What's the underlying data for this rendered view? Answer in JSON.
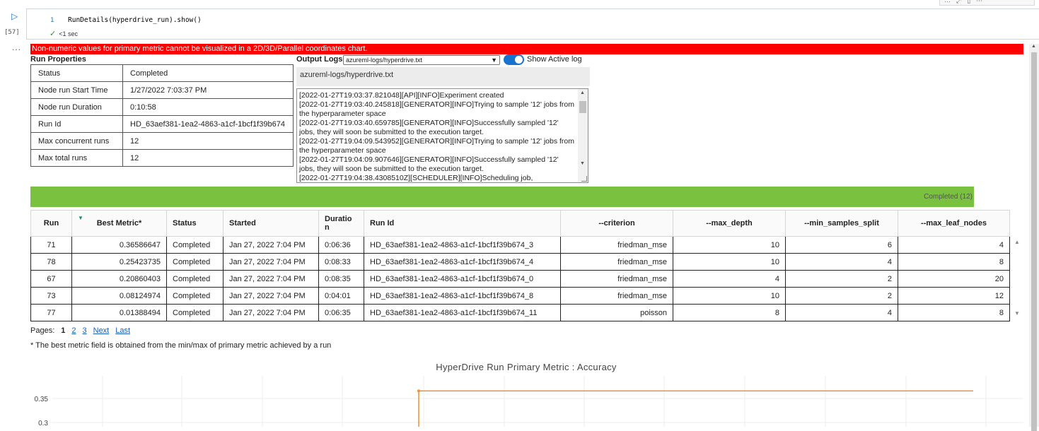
{
  "cell": {
    "execution_count": "[57]",
    "line_number": "1",
    "code": "RunDetails(hyperdrive_run).show()",
    "exec_time": "<1 sec",
    "output_prompt": "..."
  },
  "error_message": "Non-numeric values for primary metric cannot be visualized in a 2D/3D/Parallel coordinates chart.",
  "run_properties": {
    "title": "Run Properties",
    "rows": [
      {
        "key": "Status",
        "value": "Completed"
      },
      {
        "key": "Node run Start Time",
        "value": "1/27/2022 7:03:37 PM"
      },
      {
        "key": "Node run Duration",
        "value": "0:10:58"
      },
      {
        "key": "Run Id",
        "value": "HD_63aef381-1ea2-4863-a1cf-1bcf1f39b674"
      },
      {
        "key": "Max concurrent runs",
        "value": "12"
      },
      {
        "key": "Max total runs",
        "value": "12"
      }
    ]
  },
  "output_logs": {
    "title": "Output Logs",
    "selected_log": "azureml-logs/hyperdrive.txt",
    "toggle_label": "Show Active log",
    "toggle_on": true,
    "header": "azureml-logs/hyperdrive.txt",
    "lines": [
      "[2022-01-27T19:03:37.821048][API][INFO]Experiment created",
      "[2022-01-27T19:03:40.245818][GENERATOR][INFO]Trying to sample '12' jobs from the hyperparameter space",
      "[2022-01-27T19:03:40.659785][GENERATOR][INFO]Successfully sampled '12' jobs, they will soon be submitted to the execution target.",
      "[2022-01-27T19:04:09.543952][GENERATOR][INFO]Trying to sample '12' jobs from the hyperparameter space",
      "[2022-01-27T19:04:09.907646][GENERATOR][INFO]Successfully sampled '12' jobs, they will soon be submitted to the execution target.",
      "[2022-01-27T19:04:38.4308510Z][SCHEDULER][INFO]Scheduling job,"
    ]
  },
  "progress": {
    "label": "Completed (12)",
    "fraction": 1.0,
    "color": "#79c13f"
  },
  "runs": {
    "columns": [
      "Run",
      "Best Metric*",
      "Status",
      "Started",
      "Duratio n",
      "Run Id",
      "--criterion",
      "--max_depth",
      "--min_samples_split",
      "--max_leaf_nodes"
    ],
    "rows": [
      [
        "71",
        "0.36586647",
        "Completed",
        "Jan 27, 2022 7:04 PM",
        "0:06:36",
        "HD_63aef381-1ea2-4863-a1cf-1bcf1f39b674_3",
        "friedman_mse",
        "10",
        "6",
        "4"
      ],
      [
        "78",
        "0.25423735",
        "Completed",
        "Jan 27, 2022 7:04 PM",
        "0:08:33",
        "HD_63aef381-1ea2-4863-a1cf-1bcf1f39b674_4",
        "friedman_mse",
        "10",
        "4",
        "8"
      ],
      [
        "67",
        "0.20860403",
        "Completed",
        "Jan 27, 2022 7:04 PM",
        "0:08:35",
        "HD_63aef381-1ea2-4863-a1cf-1bcf1f39b674_0",
        "friedman_mse",
        "4",
        "2",
        "20"
      ],
      [
        "73",
        "0.08124974",
        "Completed",
        "Jan 27, 2022 7:04 PM",
        "0:04:01",
        "HD_63aef381-1ea2-4863-a1cf-1bcf1f39b674_8",
        "friedman_mse",
        "10",
        "2",
        "12"
      ],
      [
        "77",
        "0.01388494",
        "Completed",
        "Jan 27, 2022 7:04 PM",
        "0:06:35",
        "HD_63aef381-1ea2-4863-a1cf-1bcf1f39b674_11",
        "poisson",
        "8",
        "4",
        "8"
      ]
    ]
  },
  "pagination": {
    "label": "Pages:",
    "current": "1",
    "pages": [
      "2",
      "3"
    ],
    "next": "Next",
    "last": "Last"
  },
  "footnote": "* The best metric field is obtained from the min/max of primary metric achieved by a run",
  "chart_data": {
    "type": "line",
    "title": "HyperDrive Run Primary Metric : Accuracy",
    "y_ticks": [
      "0.35",
      "0.3"
    ],
    "ylim": [
      0.28,
      0.4
    ],
    "series": [
      {
        "values": [
          [
            0.0,
            0.36586647
          ],
          [
            1.0,
            0.36586647
          ]
        ],
        "color": "#f0913a"
      }
    ],
    "grid": true
  }
}
